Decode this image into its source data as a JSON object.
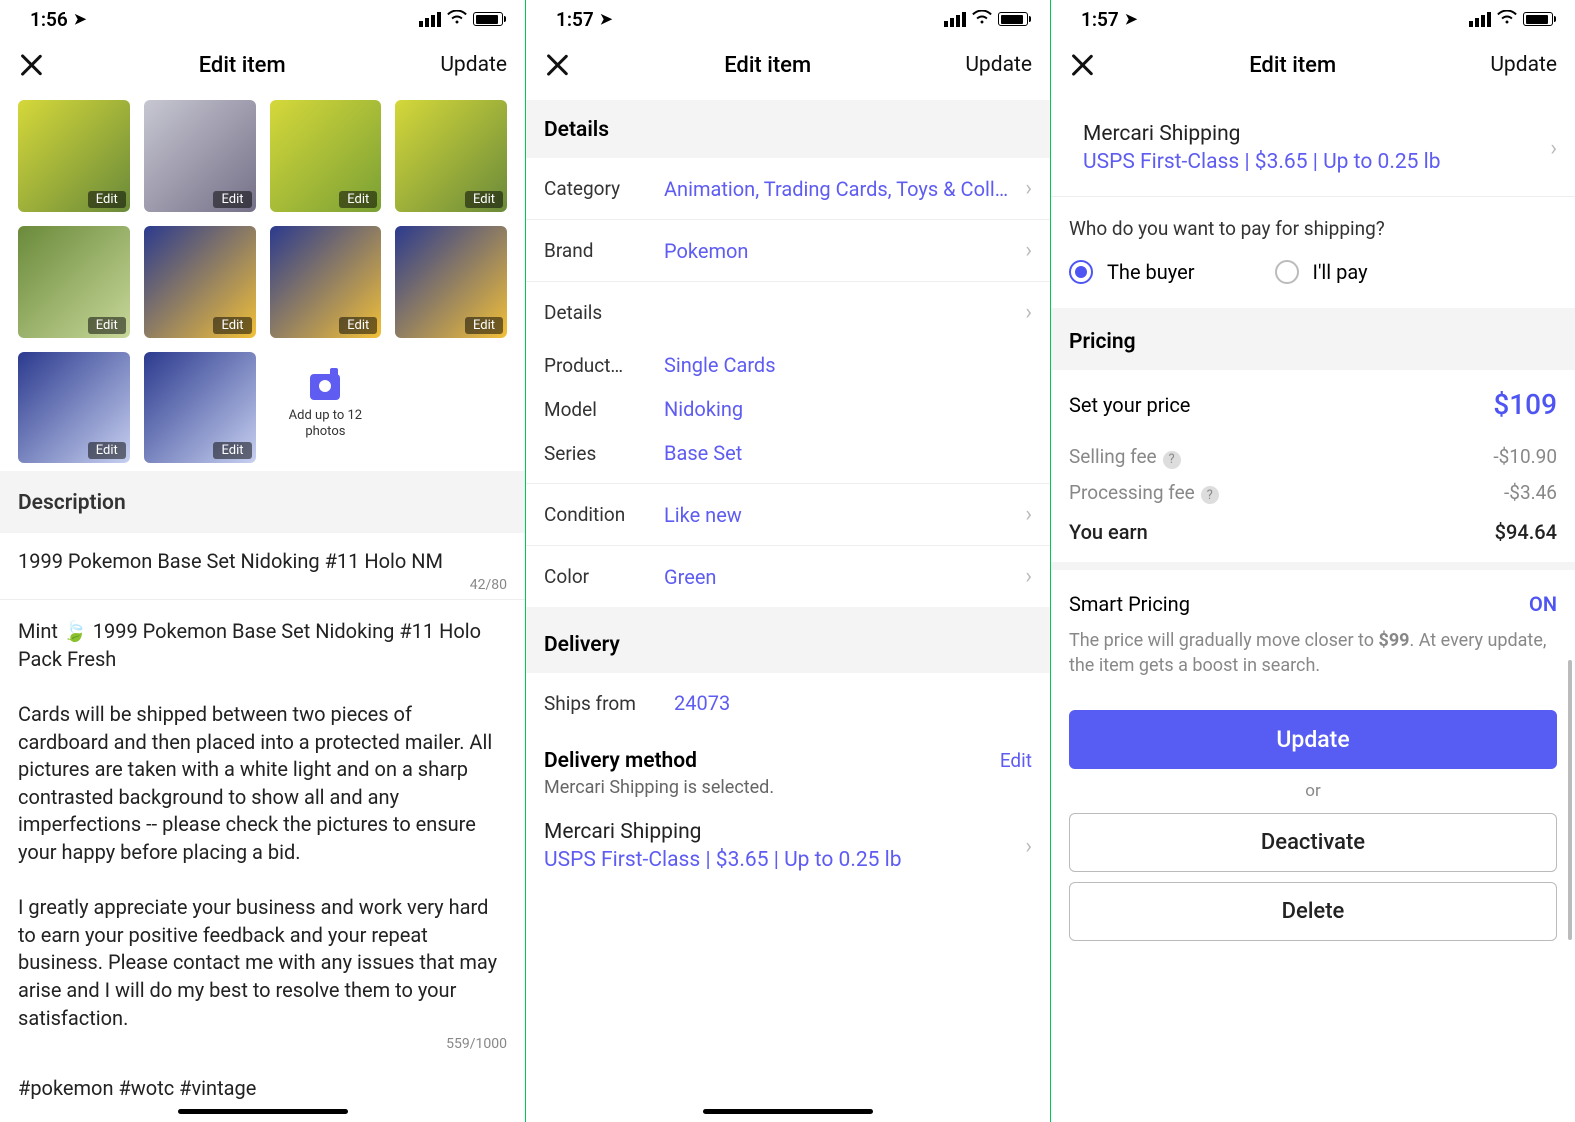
{
  "status": {
    "time1": "1:56",
    "time2": "1:57",
    "time3": "1:57"
  },
  "nav": {
    "title": "Edit item",
    "action": "Update"
  },
  "screen1": {
    "edit_label": "Edit",
    "add_label": "Add up to 12 photos",
    "desc_header": "Description",
    "title_value": "1999 Pokemon Base Set Nidoking #11 Holo NM",
    "title_count": "42/80",
    "body_value": "Mint 🍃 1999 Pokemon Base Set Nidoking #11 Holo Pack Fresh\n\nCards will be shipped between two pieces of cardboard and then placed into a protected mailer. All pictures are taken with a white light and on a sharp contrasted background to show all and any imperfections -- please check the pictures to ensure your happy before placing a bid.\n\nI greatly appreciate your business and work very hard to earn your positive feedback and your repeat business. Please contact me with any issues that may arise and I will do my best to resolve them to your satisfaction.",
    "body_count": "559/1000",
    "hashtags": "#pokemon #wotc #vintage",
    "thumb_bg": [
      "linear-gradient(135deg,#d5d83a,#6a8a3a)",
      "linear-gradient(135deg,#c7c7d2,#757088)",
      "linear-gradient(135deg,#d5d83a,#7aa035)",
      "linear-gradient(135deg,#d5d83a,#6a8a3a)",
      "linear-gradient(135deg,#6a8a3a,#c8d89a)",
      "linear-gradient(135deg,#2b3a8e,#f2c038)",
      "linear-gradient(135deg,#2b3a8e,#f2c038)",
      "linear-gradient(135deg,#2b3a8e,#f2c038)",
      "linear-gradient(135deg,#2b3a8e,#c7d0f0)",
      "linear-gradient(135deg,#2b3a8e,#c7d0f0)"
    ]
  },
  "screen2": {
    "details_header": "Details",
    "category_l": "Category",
    "category_v": "Animation, Trading Cards, Toys & Collec…",
    "brand_l": "Brand",
    "brand_v": "Pokemon",
    "details_l": "Details",
    "product_l": "Product…",
    "product_v": "Single Cards",
    "model_l": "Model",
    "model_v": "Nidoking",
    "series_l": "Series",
    "series_v": "Base Set",
    "condition_l": "Condition",
    "condition_v": "Like new",
    "color_l": "Color",
    "color_v": "Green",
    "delivery_header": "Delivery",
    "shipsfrom_l": "Ships from",
    "shipsfrom_v": "24073",
    "method_l": "Delivery method",
    "method_desc": "Mercari Shipping is selected.",
    "edit_link": "Edit",
    "ship_title": "Mercari Shipping",
    "ship_detail": "USPS First-Class | $3.65 | Up to 0.25 lb"
  },
  "screen3": {
    "ship_title": "Mercari Shipping",
    "ship_detail": "USPS First-Class | $3.65 | Up to 0.25 lb",
    "pay_q": "Who do you want to pay for shipping?",
    "opt_buyer": "The buyer",
    "opt_me": "I'll pay",
    "pricing_header": "Pricing",
    "setprice_l": "Set your price",
    "setprice_v": "$109",
    "sellfee_l": "Selling fee",
    "sellfee_v": "-$10.90",
    "procfee_l": "Processing fee",
    "procfee_v": "-$3.46",
    "earn_l": "You earn",
    "earn_v": "$94.64",
    "smart_l": "Smart Pricing",
    "smart_v": "ON",
    "smart_desc_a": "The price will gradually move closer to ",
    "smart_desc_b": "$99",
    "smart_desc_c": ". At every update, the item gets a boost in search.",
    "btn_update": "Update",
    "or": "or",
    "btn_deact": "Deactivate",
    "btn_delete": "Delete"
  }
}
